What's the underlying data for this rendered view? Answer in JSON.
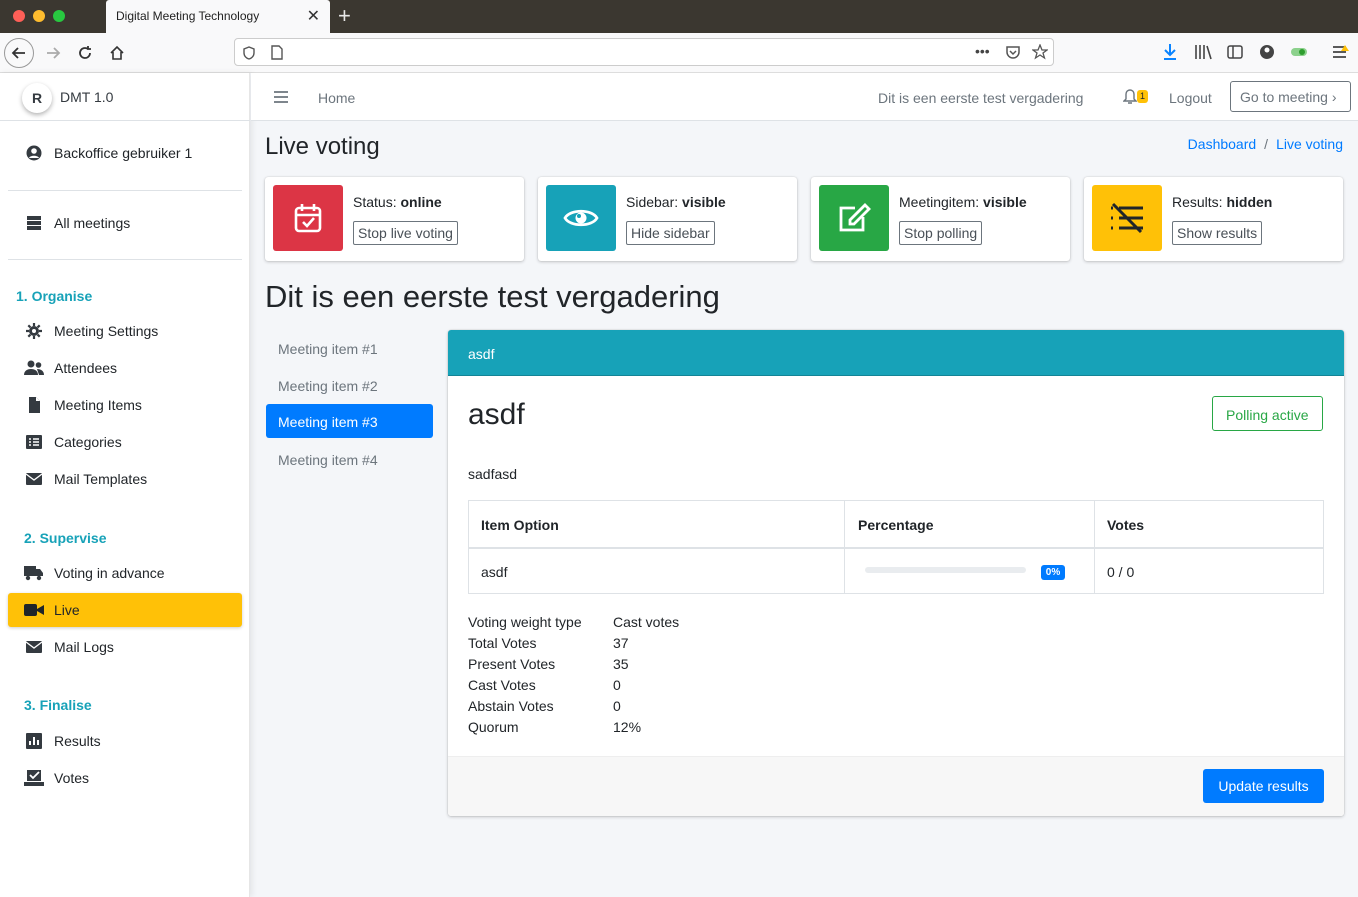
{
  "browser": {
    "tab_title": "Digital Meeting Technology",
    "tab_close": "✕",
    "new_tab": "+"
  },
  "sidebar": {
    "brand": "DMT 1.0",
    "logo_letter": "R",
    "user": "Backoffice gebruiker 1",
    "all_meetings": "All meetings",
    "sections": {
      "organise": "1. Organise",
      "supervise": "2. Supervise",
      "finalise": "3. Finalise"
    },
    "items": {
      "meeting_settings": "Meeting Settings",
      "attendees": "Attendees",
      "meeting_items": "Meeting Items",
      "categories": "Categories",
      "mail_templates": "Mail Templates",
      "voting_in_advance": "Voting in advance",
      "live": "Live",
      "mail_logs": "Mail Logs",
      "results": "Results",
      "votes": "Votes"
    }
  },
  "topnav": {
    "home": "Home",
    "meeting_name": "Dit is een eerste test vergadering",
    "notification_count": "1",
    "logout": "Logout",
    "go_to_meeting": "Go to meeting ›"
  },
  "page": {
    "title": "Live voting",
    "breadcrumb": {
      "dashboard": "Dashboard",
      "sep": "/",
      "current": "Live voting"
    }
  },
  "status_boxes": [
    {
      "label": "Status: ",
      "value": "online",
      "button": "Stop live voting",
      "color": "#dc3545",
      "icon": "calendar-check-icon"
    },
    {
      "label": "Sidebar: ",
      "value": "visible",
      "button": "Hide sidebar",
      "color": "#17a2b8",
      "icon": "eye-icon"
    },
    {
      "label": "Meetingitem: ",
      "value": "visible",
      "button": "Stop polling",
      "color": "#28a745",
      "icon": "edit-icon"
    },
    {
      "label": "Results: ",
      "value": "hidden",
      "button": "Show results",
      "color": "#ffc107",
      "icon": "list-off-icon"
    }
  ],
  "meeting": {
    "title": "Dit is een eerste test vergadering",
    "items": [
      "Meeting item #1",
      "Meeting item #2",
      "Meeting item #3",
      "Meeting item #4"
    ],
    "active_item": "Meeting item #3"
  },
  "card": {
    "header": "asdf",
    "question_title": "asdf",
    "polling_status": "Polling active",
    "description": "sadfasd",
    "table": {
      "headers": [
        "Item Option",
        "Percentage",
        "Votes"
      ],
      "rows": [
        {
          "option": "asdf",
          "percentage_label": "0%",
          "percentage": 0,
          "votes": "0 / 0"
        }
      ]
    },
    "stats": [
      {
        "label": "Voting weight type",
        "value": "Cast votes"
      },
      {
        "label": "Total Votes",
        "value": "37"
      },
      {
        "label": "Present Votes",
        "value": "35"
      },
      {
        "label": "Cast Votes",
        "value": "0"
      },
      {
        "label": "Abstain Votes",
        "value": "0"
      },
      {
        "label": "Quorum",
        "value": "12%"
      }
    ],
    "update_button": "Update results"
  }
}
